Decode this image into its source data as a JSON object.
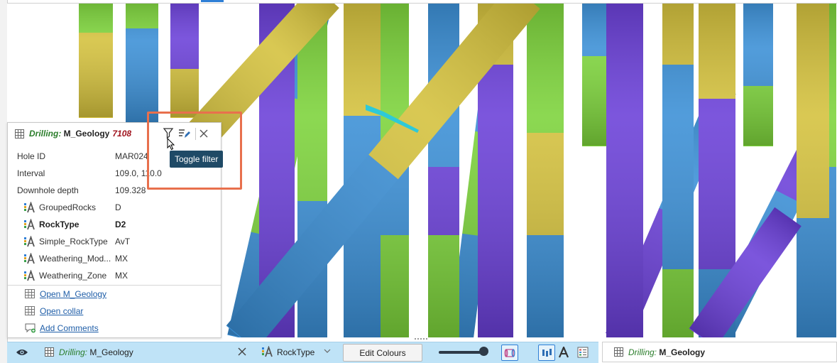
{
  "panel": {
    "title_prefix": "Drilling:",
    "title_name": "M_Geology",
    "title_count": "7108",
    "rows": [
      {
        "label": "Hole ID",
        "value": "MAR024"
      },
      {
        "label": "Interval",
        "value": "109.0, 110.0"
      },
      {
        "label": "Downhole depth",
        "value": "109.328"
      },
      {
        "label": "GroupedRocks",
        "value": "D"
      },
      {
        "label": "RockType",
        "value": "D2"
      },
      {
        "label": "Simple_RockType",
        "value": "AvT"
      },
      {
        "label": "Weathering_Mod...",
        "value": "MX"
      },
      {
        "label": "Weathering_Zone",
        "value": "MX"
      }
    ],
    "links": [
      {
        "label": "Open M_Geology",
        "icon": "table-icon"
      },
      {
        "label": "Open collar",
        "icon": "table-icon"
      },
      {
        "label": "Add Comments",
        "icon": "comment-add-icon"
      }
    ]
  },
  "tooltip": {
    "text": "Toggle filter"
  },
  "scene_bar": {
    "object_prefix": "Drilling:",
    "object_name": "M_Geology",
    "colour_column": "RockType",
    "edit_colours_label": "Edit Colours",
    "opacity": 1.0
  },
  "right_bar": {
    "object_prefix": "Drilling:",
    "object_name": "M_Geology"
  },
  "colors": {
    "yellow": "#d4c13c",
    "purple": "#6a3fd8",
    "blue": "#3a8fd6",
    "green": "#7cd33a",
    "cyan_marker": "#2ec9d8",
    "highlight": "#e8704d",
    "tooltip_bg": "#1f4a66"
  }
}
